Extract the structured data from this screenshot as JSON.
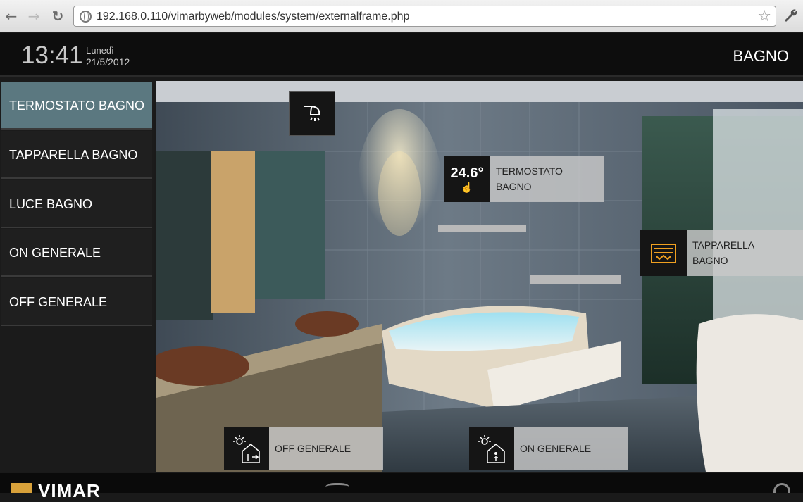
{
  "browser": {
    "url": "192.168.0.110/vimarbyweb/modules/system/externalframe.php",
    "back_glyph": "←",
    "forward_glyph": "→",
    "reload_glyph": "↻",
    "star_glyph": "☆"
  },
  "header": {
    "time": "13:41",
    "day": "Lunedì",
    "date": "21/5/2012",
    "room": "BAGNO"
  },
  "sidebar": {
    "items": [
      {
        "label": "TERMOSTATO BAGNO",
        "active": true
      },
      {
        "label": "TAPPARELLA BAGNO",
        "active": false
      },
      {
        "label": "LUCE BAGNO",
        "active": false
      },
      {
        "label": "ON GENERALE",
        "active": false
      },
      {
        "label": "OFF GENERALE",
        "active": false
      }
    ]
  },
  "widgets": {
    "thermostat": {
      "value": "24.6°",
      "line1": "TERMOSTATO",
      "line2": "BAGNO"
    },
    "shutter": {
      "line1": "TAPPARELLA",
      "line2": "BAGNO"
    },
    "off_general": {
      "label": "OFF GENERALE"
    },
    "on_general": {
      "label": "ON GENERALE"
    }
  },
  "footer": {
    "brand": "VIMAR"
  },
  "colors": {
    "active_item": "#5b7880",
    "shutter_icon": "#f0a020"
  }
}
